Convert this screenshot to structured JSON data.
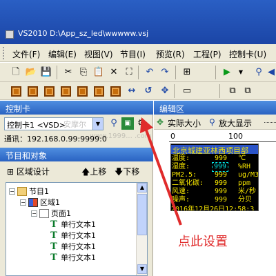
{
  "window": {
    "title": "VS2010 D:\\App_sz_led\\wwwww.vsj"
  },
  "menu": [
    "文件(F)",
    "编辑(E)",
    "视图(V)",
    "节目(I)",
    "预览(R)",
    "工程(P)",
    "控制卡(U)"
  ],
  "toolbar1": {
    "icons": [
      "new-file-icon",
      "open-folder-icon",
      "save-icon",
      "cut-icon",
      "copy-icon",
      "paste-icon",
      "delete-icon",
      "select-icon",
      "undo-icon",
      "redo-icon",
      "grid-icon",
      "play-icon",
      "dropdown-icon",
      "debug-icon",
      "config-icon"
    ]
  },
  "toolbar2": {
    "icons": [
      "square-1-icon",
      "square-2-icon",
      "square-3-icon",
      "square-4-icon",
      "square-5-icon",
      "square-6-icon",
      "square-7-icon",
      "expand-h-icon",
      "rotate-left-icon",
      "fullscreen-icon",
      "window-icon",
      "layer-1-icon",
      "layer-2-icon"
    ]
  },
  "control_card": {
    "header": "控制卡",
    "selected": "控制卡1 <VSD>",
    "comm": "通讯：192.168.0.99:9999:0",
    "watermark": "安摩尔",
    "watermark2": "www.1999... .com"
  },
  "objects": {
    "header": "节目和对象",
    "area_design": "区域设计",
    "move_up": "上移",
    "move_down": "下移",
    "tree": [
      {
        "label": "节目1",
        "level": 0
      },
      {
        "label": "区域1",
        "level": 1
      },
      {
        "label": "页面1",
        "level": 2
      },
      {
        "label": "单行文本1",
        "level": 3
      },
      {
        "label": "单行文本1",
        "level": 3
      },
      {
        "label": "单行文本1",
        "level": 3
      },
      {
        "label": "单行文本1",
        "level": 3
      }
    ]
  },
  "editor": {
    "header": "编辑区",
    "actual_size": "实际大小",
    "zoom": "放大显示",
    "ruler": [
      "0",
      "100"
    ],
    "led": {
      "title": "北京城建亚林西项目部",
      "rows": [
        {
          "label": "温度:",
          "value": "999",
          "unit": "℃"
        },
        {
          "label": "湿度:",
          "value": "999",
          "unit": "%RH"
        },
        {
          "label": "PM2.5:",
          "value": "999",
          "unit": "ug/M3"
        },
        {
          "label": "二氧化碳:",
          "value": "999",
          "unit": "ppm"
        },
        {
          "label": "风速:",
          "value": "999",
          "unit": "米/秒"
        },
        {
          "label": "噪声:",
          "value": "999",
          "unit": "分贝"
        }
      ],
      "datetime": "2016年12月26日12:58:3"
    }
  },
  "annotation": "点此设置",
  "colors": {
    "title_blue": "#1b45a6",
    "led_yellow": "#f7e600",
    "annotation_red": "#e02b2b"
  }
}
